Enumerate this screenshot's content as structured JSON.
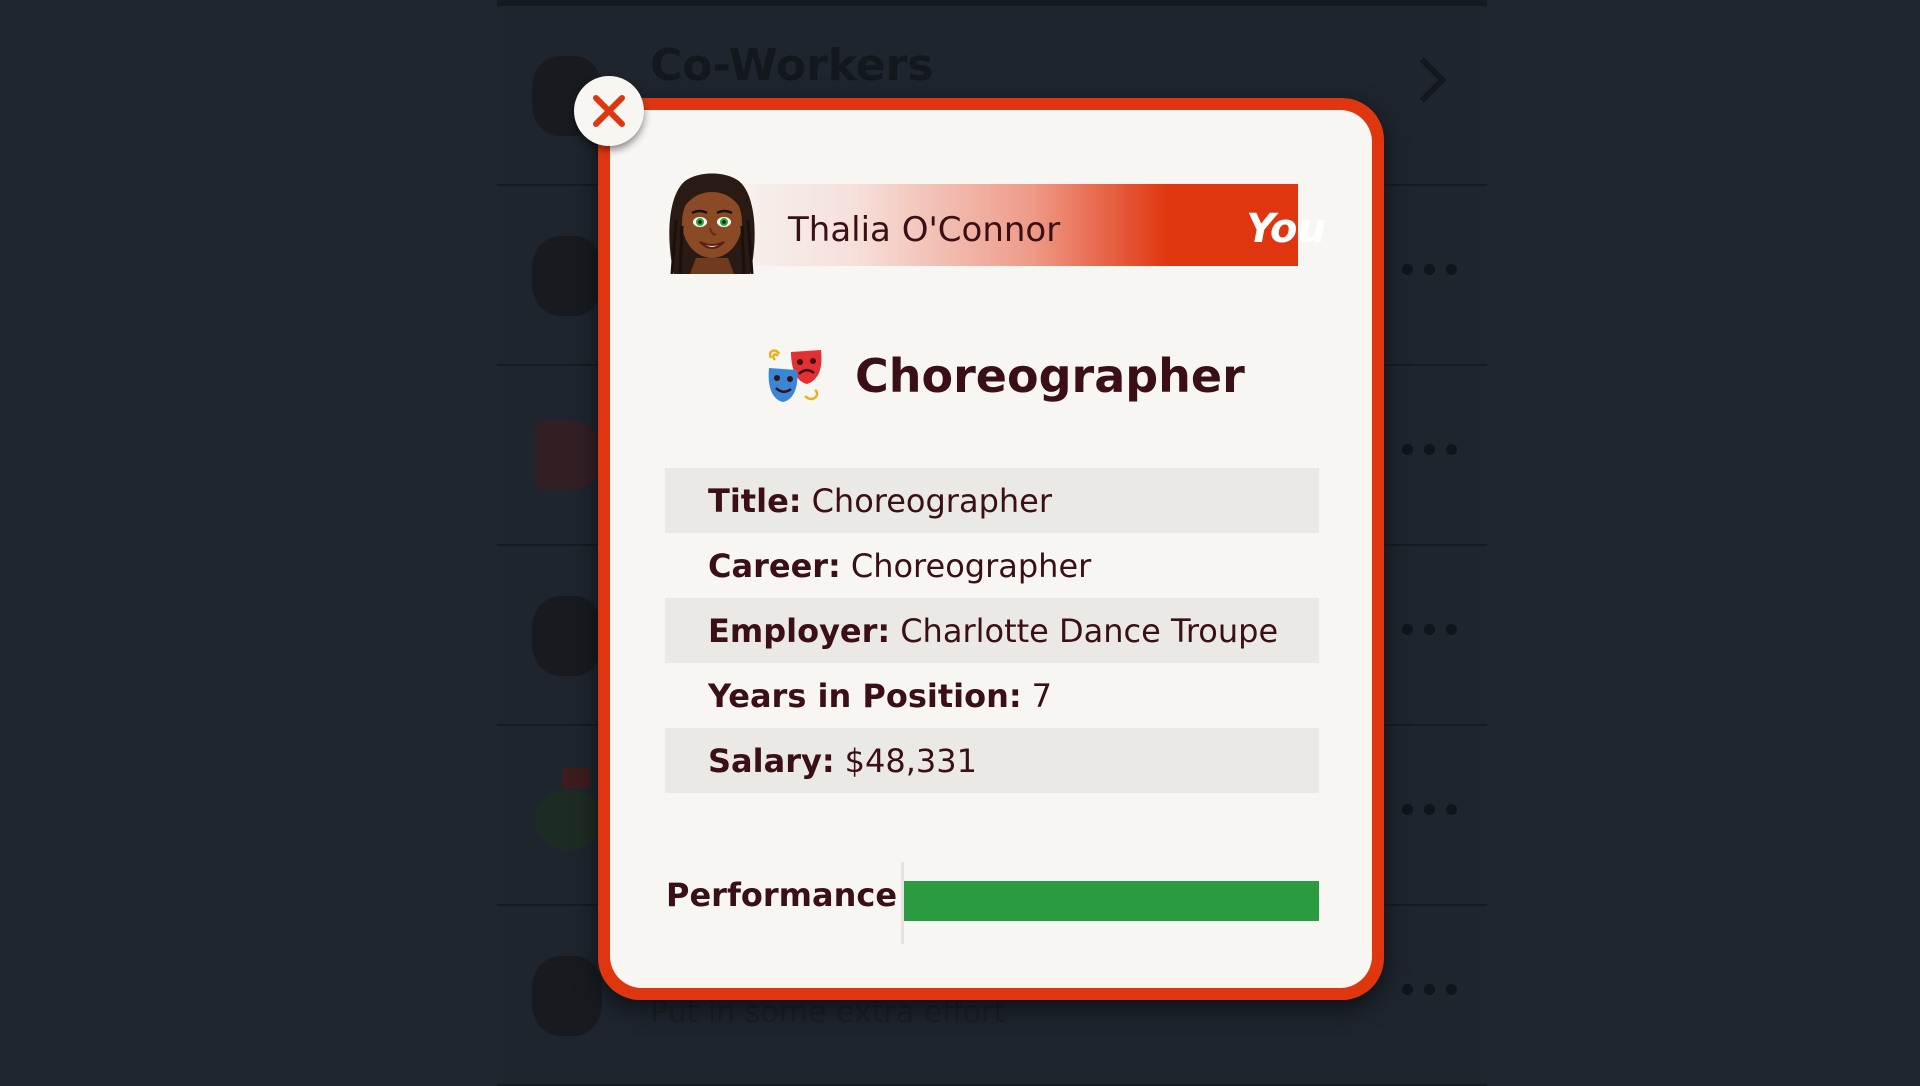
{
  "background": {
    "section_title": "Co-Workers",
    "row_subtext": "Put in some extra effort"
  },
  "dialog": {
    "person": {
      "name": "Thalia O'Connor",
      "tag": "You",
      "avatar_icon": "avatar-icon"
    },
    "job": {
      "icon": "theater-masks-icon",
      "title": "Choreographer"
    },
    "details": [
      {
        "label": "Title:",
        "value": "Choreographer"
      },
      {
        "label": "Career:",
        "value": "Choreographer"
      },
      {
        "label": "Employer:",
        "value": "Charlotte Dance Troupe"
      },
      {
        "label": "Years in Position:",
        "value": "7"
      },
      {
        "label": "Salary:",
        "value": "$48,331"
      }
    ],
    "performance": {
      "label": "Performance",
      "level": 1.0,
      "color": "#2a9b40"
    },
    "colors": {
      "accent": "#e0360f",
      "card": "#f7f6f3",
      "text": "#3a1016"
    }
  }
}
